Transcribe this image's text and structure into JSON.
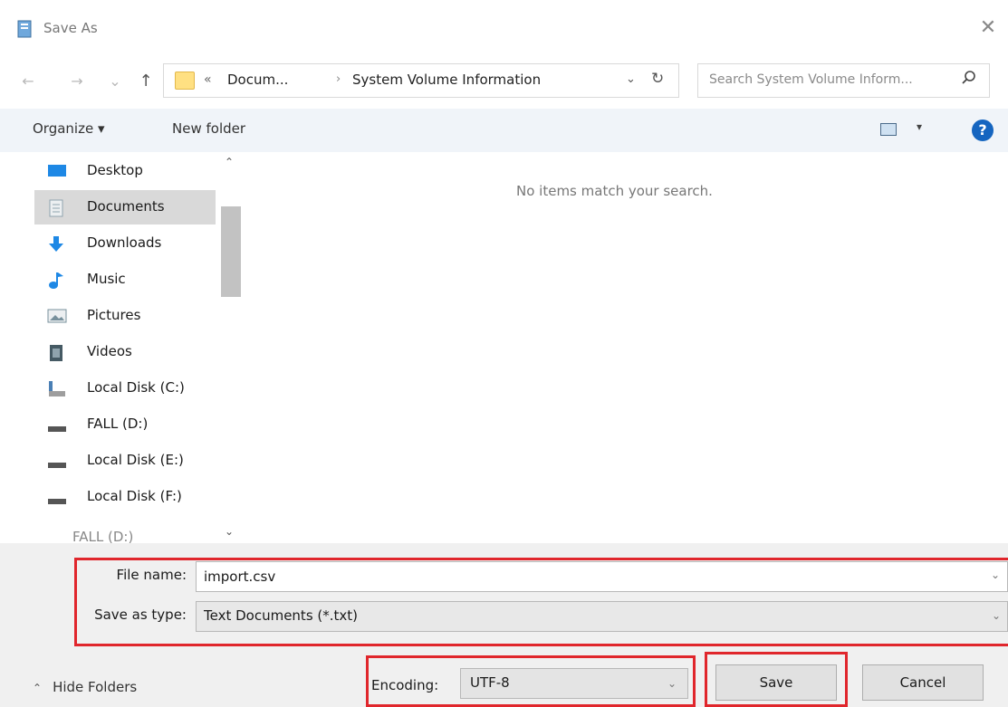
{
  "window": {
    "title": "Save As",
    "close_glyph": "✕"
  },
  "address": {
    "back_glyph": "←",
    "forward_glyph": "→",
    "recent_glyph": "⌄",
    "up_glyph": "↑",
    "chevrons": "«",
    "segment1": "Docum...",
    "separator": "›",
    "segment2": "System Volume Information",
    "dropdown_glyph": "⌄",
    "refresh_glyph": "↻",
    "search_placeholder": "Search System Volume Inform...",
    "search_glyph": "⌕"
  },
  "toolbar": {
    "organize_label": "Organize ▾",
    "new_folder_label": "New folder",
    "view_dropdown_glyph": "▾",
    "help_glyph": "?"
  },
  "sidebar": {
    "items": [
      {
        "label": "Desktop",
        "icon": "desktop-icon",
        "color": "#1e88e5"
      },
      {
        "label": "Documents",
        "icon": "documents-icon",
        "color": "#90a4ae",
        "selected": true
      },
      {
        "label": "Downloads",
        "icon": "downloads-icon",
        "color": "#1e88e5"
      },
      {
        "label": "Music",
        "icon": "music-icon",
        "color": "#1e88e5"
      },
      {
        "label": "Pictures",
        "icon": "pictures-icon",
        "color": "#78909c"
      },
      {
        "label": "Videos",
        "icon": "videos-icon",
        "color": "#455a64"
      },
      {
        "label": "Local Disk (C:)",
        "icon": "system-disk-icon",
        "color": "#4a7fb5"
      },
      {
        "label": "FALL (D:)",
        "icon": "drive-icon",
        "color": "#555555"
      },
      {
        "label": "Local Disk (E:)",
        "icon": "drive-icon",
        "color": "#555555"
      },
      {
        "label": "Local Disk (F:)",
        "icon": "drive-icon",
        "color": "#555555"
      },
      {
        "label": "FALL (D:)",
        "icon": "drive-icon",
        "color": "#555555"
      }
    ],
    "scroll_up_glyph": "⌃",
    "scroll_down_glyph": "⌄"
  },
  "content": {
    "empty_message": "No items match your search."
  },
  "form": {
    "file_name_label": "File name:",
    "file_name_value": "import.csv",
    "save_as_type_label": "Save as type:",
    "save_as_type_value": "Text Documents (*.txt)",
    "dropdown_glyph": "⌄",
    "encoding_label": "Encoding:",
    "encoding_value": "UTF-8"
  },
  "footer": {
    "hide_folders_glyph": "⌃",
    "hide_folders_label": "Hide Folders",
    "save_label": "Save",
    "cancel_label": "Cancel"
  },
  "colors": {
    "highlight_border": "#e0262c",
    "help_blue": "#1565c0",
    "toolbar_bg": "#f0f4f9"
  }
}
